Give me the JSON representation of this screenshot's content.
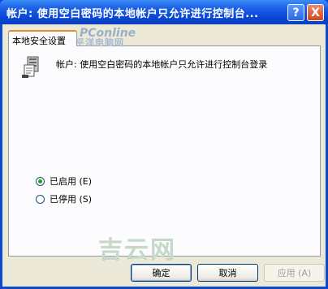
{
  "window": {
    "title": "帐户: 使用空白密码的本地帐户只允许进行控制台..."
  },
  "title_buttons": {
    "help": "?",
    "close": "X"
  },
  "tab": {
    "label": "本地安全设置"
  },
  "policy": {
    "text": "帐户: 使用空白密码的本地帐户只允许进行控制台登录"
  },
  "options": [
    {
      "label": "已启用 (E)",
      "selected": true
    },
    {
      "label": "已停用 (S)",
      "selected": false
    }
  ],
  "watermarks": {
    "pconline": "PConline",
    "pconline_cn": "平洋电脑网",
    "site": "吉云网"
  },
  "buttons": {
    "ok": "确定",
    "cancel": "取消",
    "apply": "应用 (A)"
  },
  "colors": {
    "titlebar": "#0a48d6",
    "tab_accent": "#e68b2c",
    "radio_dot": "#21a121"
  }
}
